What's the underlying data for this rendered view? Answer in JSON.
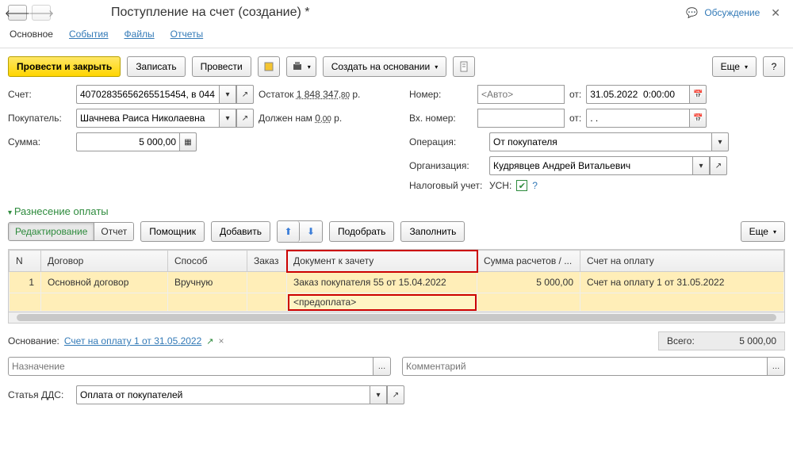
{
  "header": {
    "title": "Поступление на счет (создание) *",
    "discuss": "Обсуждение"
  },
  "tabs": [
    "Основное",
    "События",
    "Файлы",
    "Отчеты"
  ],
  "toolbar": {
    "post_close": "Провести и закрыть",
    "write": "Записать",
    "post": "Провести",
    "create_based": "Создать на основании",
    "more": "Еще"
  },
  "fields": {
    "account_label": "Счет:",
    "account_value": "40702835656265515454, в 044",
    "balance_label": "Остаток",
    "balance_main": "1 848 347",
    "balance_kop": ",80",
    "balance_cur": "р.",
    "buyer_label": "Покупатель:",
    "buyer_value": "Шачнева Раиса Николаевна",
    "debt_label": "Должен нам",
    "debt_main": "0",
    "debt_kop": ",00",
    "debt_cur": "р.",
    "amount_label": "Сумма:",
    "amount_value": "5 000,00",
    "number_label": "Номер:",
    "number_placeholder": "<Авто>",
    "from_label": "от:",
    "date_value": "31.05.2022  0:00:00",
    "in_number_label": "Вх. номер:",
    "in_from_value": ". .",
    "operation_label": "Операция:",
    "operation_value": "От покупателя",
    "org_label": "Организация:",
    "org_value": "Кудрявцев Андрей Витальевич",
    "tax_label": "Налоговый учет:",
    "tax_value": "УСН:"
  },
  "section": {
    "title": "Разнесение оплаты",
    "edit_mode": "Редактирование",
    "report_mode": "Отчет",
    "helper": "Помощник",
    "add": "Добавить",
    "pick": "Подобрать",
    "fill": "Заполнить",
    "more": "Еще"
  },
  "table": {
    "headers": {
      "n": "N",
      "dogovor": "Договор",
      "sposob": "Способ",
      "zakaz": "Заказ",
      "doc": "Документ к зачету",
      "sum": "Сумма расчетов / ...",
      "schet": "Счет на оплату"
    },
    "rows": [
      {
        "n": "1",
        "dogovor": "Основной договор",
        "sposob": "Вручную",
        "zakaz": "",
        "doc": "Заказ покупателя 55 от 15.04.2022",
        "sum": "5 000,00",
        "schet": "Счет на оплату 1 от 31.05.2022",
        "doc2": "<предоплата>"
      }
    ]
  },
  "footer": {
    "basis_label": "Основание:",
    "basis_link": "Счет на оплату 1 от 31.05.2022",
    "total_label": "Всего:",
    "total_value": "5 000,00",
    "purpose_ph": "Назначение",
    "comment_ph": "Комментарий",
    "dds_label": "Статья ДДС:",
    "dds_value": "Оплата от покупателей"
  }
}
